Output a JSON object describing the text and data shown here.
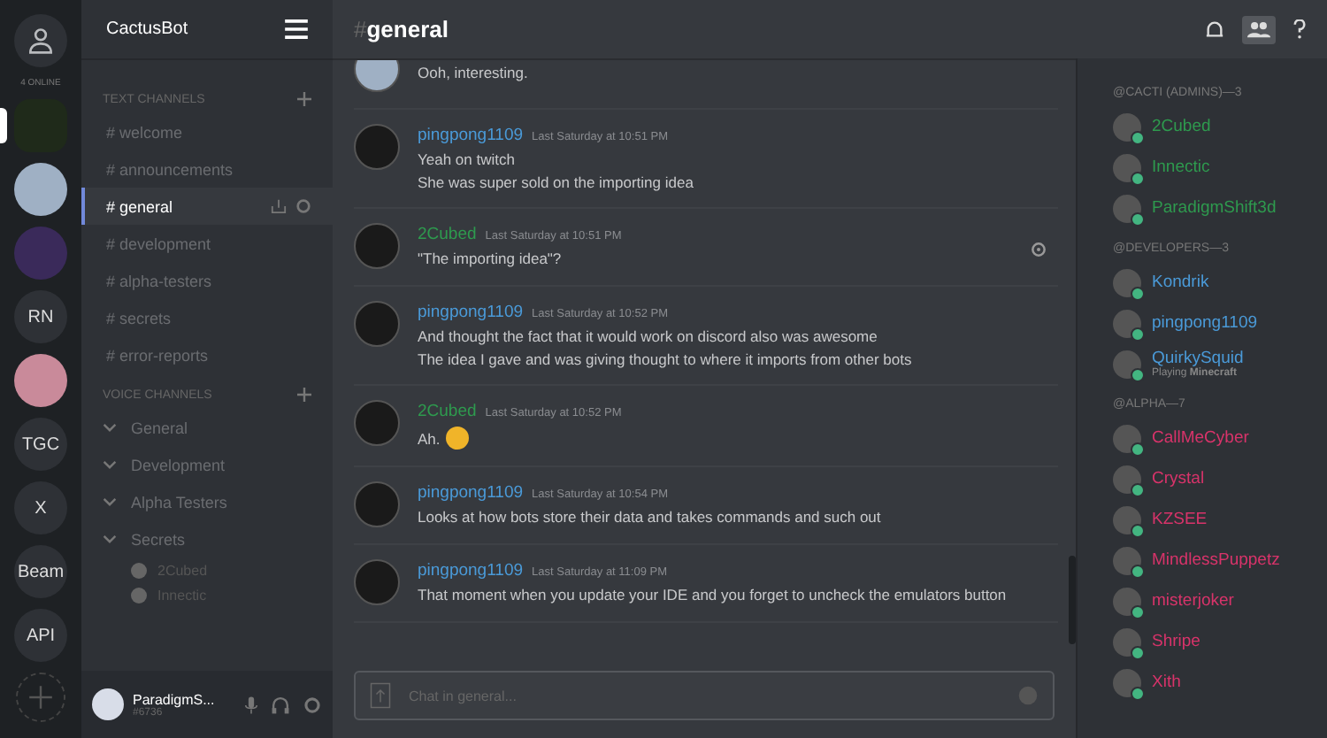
{
  "servers": {
    "online_label": "4 ONLINE",
    "items": [
      {
        "kind": "image",
        "color": "#1f2a1a",
        "selected": true
      },
      {
        "kind": "image",
        "color": "#9fb0c4",
        "selected": false
      },
      {
        "kind": "image",
        "color": "#3a2a5a",
        "selected": false
      },
      {
        "kind": "text",
        "label": "RN",
        "selected": false
      },
      {
        "kind": "image",
        "color": "#c98a9a",
        "selected": false
      },
      {
        "kind": "text",
        "label": "TGC",
        "selected": false
      },
      {
        "kind": "text",
        "label": "X",
        "selected": false
      },
      {
        "kind": "text",
        "label": "Beam",
        "selected": false
      },
      {
        "kind": "text",
        "label": "API",
        "selected": false
      }
    ]
  },
  "channels": {
    "server_name": "CactusBot",
    "text_header": "TEXT CHANNELS",
    "text_channels": [
      {
        "name": "# welcome",
        "selected": false
      },
      {
        "name": "# announcements",
        "selected": false
      },
      {
        "name": "# general",
        "selected": true
      },
      {
        "name": "# development",
        "selected": false
      },
      {
        "name": "# alpha-testers",
        "selected": false
      },
      {
        "name": "# secrets",
        "selected": false
      },
      {
        "name": "# error-reports",
        "selected": false
      }
    ],
    "voice_header": "VOICE CHANNELS",
    "voice_channels": [
      {
        "name": "General"
      },
      {
        "name": "Development"
      },
      {
        "name": "Alpha Testers"
      },
      {
        "name": "Secrets",
        "users": [
          "2Cubed",
          "Innectic"
        ]
      }
    ],
    "user": {
      "name": "ParadigmS...",
      "tag": "#6736"
    }
  },
  "chat": {
    "hash": "#",
    "channel": "general",
    "placeholder": "Chat in general...",
    "messages": [
      {
        "kind": "continued",
        "lines": [
          "Ooh, interesting."
        ]
      },
      {
        "kind": "full",
        "author": "pingpong1109",
        "color": "#4a9ad8",
        "time": "Last Saturday at 10:51 PM",
        "lines": [
          "Yeah on twitch",
          "She was super sold on the importing idea"
        ]
      },
      {
        "kind": "full",
        "author": "2Cubed",
        "color": "#2e9a4e",
        "time": "Last Saturday at 10:51 PM",
        "lines": [
          "\"The importing idea\"?"
        ]
      },
      {
        "kind": "full",
        "author": "pingpong1109",
        "color": "#4a9ad8",
        "time": "Last Saturday at 10:52 PM",
        "lines": [
          "And thought the fact that it would work on discord also was awesome",
          "The idea I gave and was giving thought to where it imports from other bots"
        ]
      },
      {
        "kind": "full",
        "author": "2Cubed",
        "color": "#2e9a4e",
        "time": "Last Saturday at 10:52 PM",
        "lines": [
          "Ah."
        ],
        "emoji": true
      },
      {
        "kind": "full",
        "author": "pingpong1109",
        "color": "#4a9ad8",
        "time": "Last Saturday at 10:54 PM",
        "lines": [
          "Looks at how bots store their data and takes commands and such out"
        ]
      },
      {
        "kind": "full",
        "author": "pingpong1109",
        "color": "#4a9ad8",
        "time": "Last Saturday at 11:09 PM",
        "lines": [
          "That moment when you update your IDE and you forget to uncheck the emulators button"
        ]
      }
    ]
  },
  "members": [
    {
      "title": "@CACTI (ADMINS)—3",
      "color": "#2e9a4e",
      "people": [
        {
          "name": "2Cubed"
        },
        {
          "name": "Innectic"
        },
        {
          "name": "ParadigmShift3d"
        }
      ]
    },
    {
      "title": "@DEVELOPERS—3",
      "color": "#4a9ad8",
      "people": [
        {
          "name": "Kondrik"
        },
        {
          "name": "pingpong1109"
        },
        {
          "name": "QuirkySquid",
          "activity": "Playing **Minecraft**"
        }
      ]
    },
    {
      "title": "@ALPHA—7",
      "color": "#d8336a",
      "people": [
        {
          "name": "CallMeCyber"
        },
        {
          "name": "Crystal"
        },
        {
          "name": "KZSEE"
        },
        {
          "name": "MindlessPuppetz"
        },
        {
          "name": "misterjoker"
        },
        {
          "name": "Shripe"
        },
        {
          "name": "Xith"
        }
      ]
    }
  ]
}
